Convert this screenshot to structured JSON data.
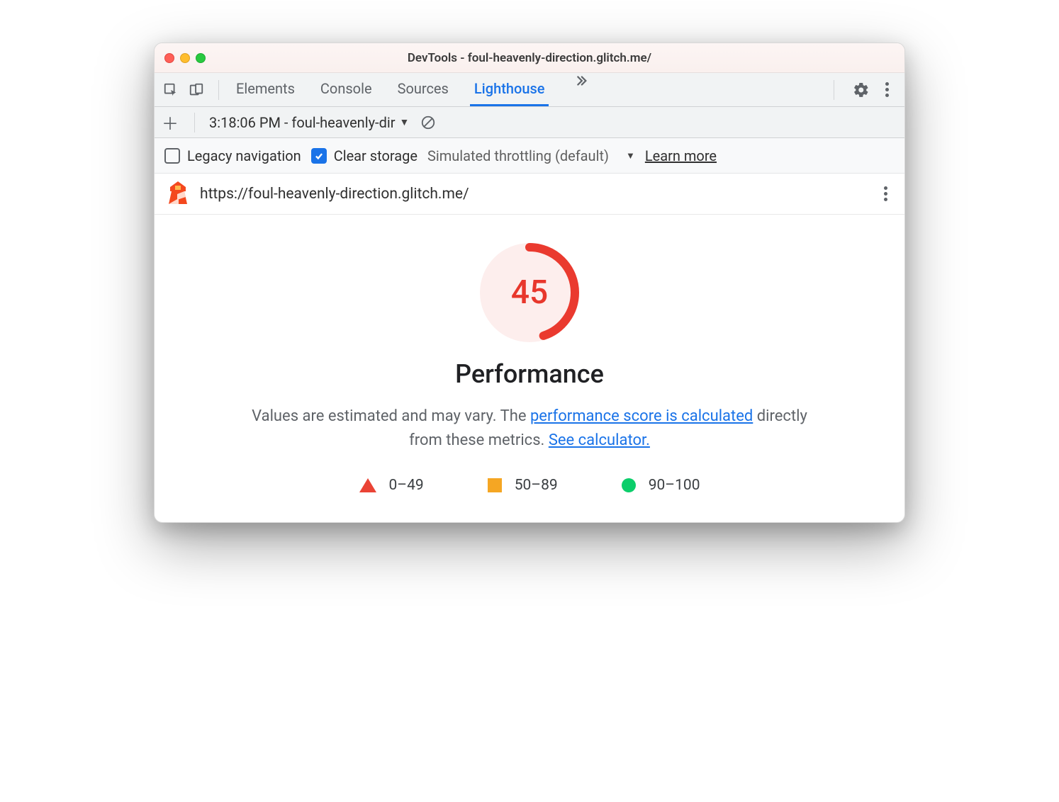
{
  "window": {
    "title": "DevTools - foul-heavenly-direction.glitch.me/"
  },
  "tabs": {
    "items": [
      "Elements",
      "Console",
      "Sources",
      "Lighthouse"
    ],
    "active_index": 3
  },
  "subbar": {
    "report_label": "3:18:06 PM - foul-heavenly-dir"
  },
  "options": {
    "legacy_label": "Legacy navigation",
    "legacy_checked": false,
    "clear_label": "Clear storage",
    "clear_checked": true,
    "throttling_label": "Simulated throttling (default)",
    "learn_more": "Learn more"
  },
  "report": {
    "url": "https://foul-heavenly-direction.glitch.me/",
    "score": "45",
    "category": "Performance",
    "desc_pre": "Values are estimated and may vary. The ",
    "desc_link1": "performance score is calculated",
    "desc_mid": " directly from these metrics. ",
    "desc_link2": "See calculator."
  },
  "legend": {
    "r1": "0–49",
    "r2": "50–89",
    "r3": "90–100"
  }
}
